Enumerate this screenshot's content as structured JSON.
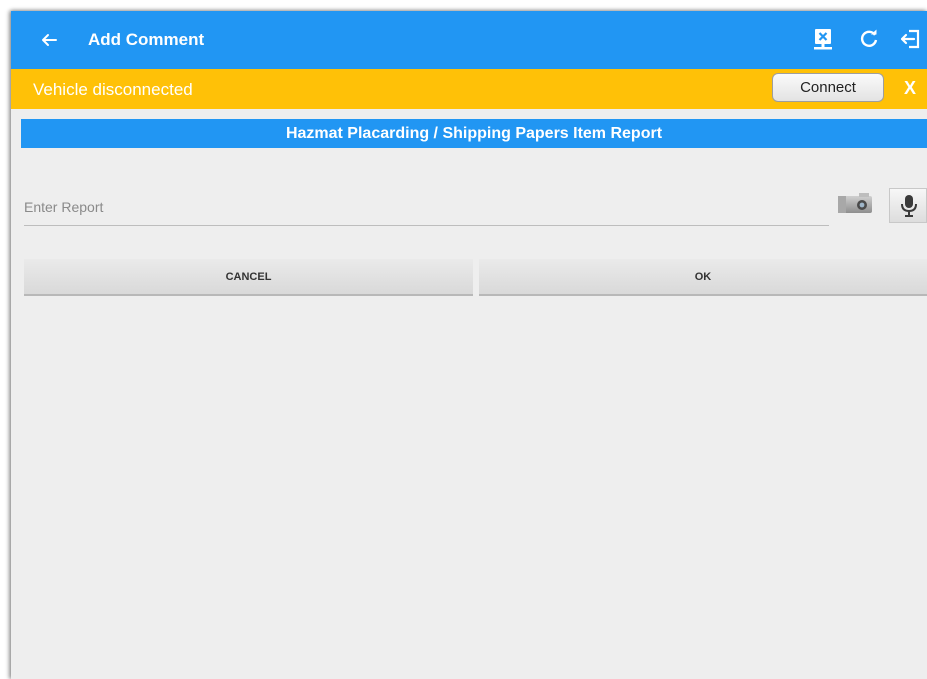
{
  "appbar": {
    "title": "Add Comment",
    "icons": [
      "back-arrow-icon",
      "disconnected-device-icon",
      "refresh-icon",
      "logout-icon"
    ]
  },
  "banner": {
    "message": "Vehicle disconnected",
    "connect_label": "Connect",
    "close_label": "X"
  },
  "report": {
    "header": "Hazmat Placarding / Shipping Papers Item Report",
    "placeholder": "Enter Report",
    "value": "",
    "icons": [
      "camera-icon",
      "microphone-icon"
    ]
  },
  "actions": {
    "cancel_label": "CANCEL",
    "ok_label": "OK"
  },
  "colors": {
    "appbar": "#2196f3",
    "banner": "#ffc107",
    "background": "#eeeeee"
  }
}
